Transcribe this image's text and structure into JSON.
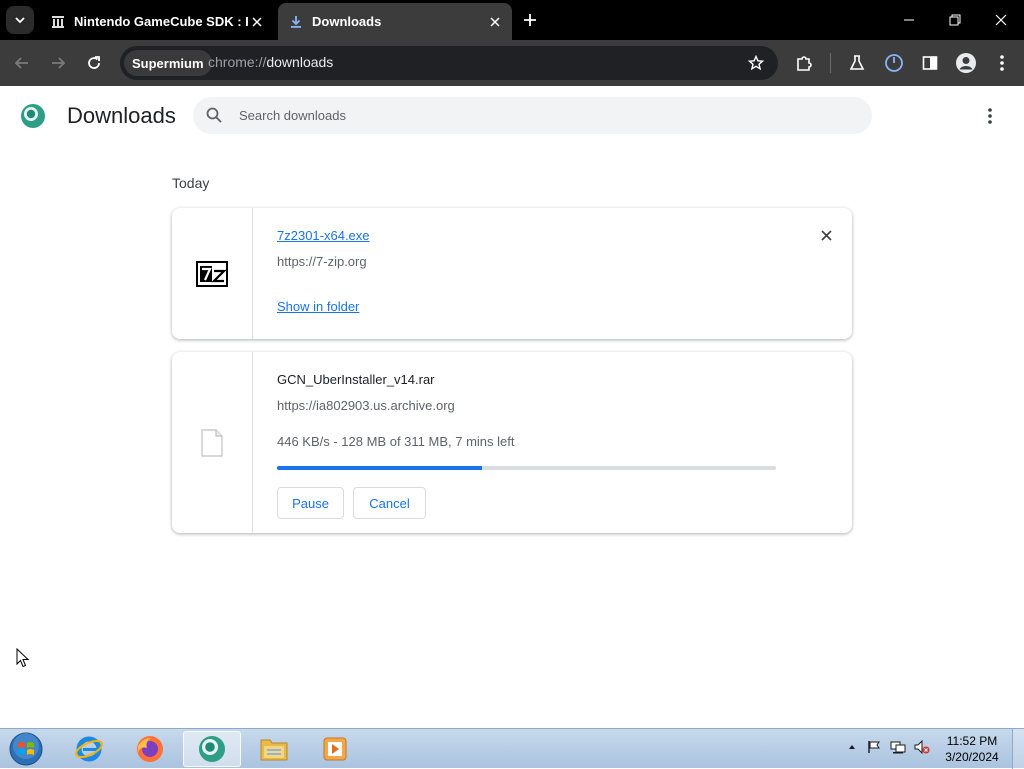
{
  "browser": {
    "tabs": [
      {
        "title": "Nintendo GameCube SDK : Free",
        "active": false
      },
      {
        "title": "Downloads",
        "active": true
      }
    ],
    "omnibox": {
      "chip": "Supermium",
      "url_scheme": "chrome://",
      "url_host": "downloads"
    }
  },
  "page": {
    "title": "Downloads",
    "search_placeholder": "Search downloads",
    "section": "Today"
  },
  "downloads": [
    {
      "filename": "7z2301-x64.exe",
      "source": "https://7-zip.org",
      "action": "Show in folder",
      "icon": "7z-icon"
    },
    {
      "filename": "GCN_UberInstaller_v14.rar",
      "source": "https://ia802903.us.archive.org",
      "status": "446 KB/s - 128 MB of 311 MB, 7 mins left",
      "progress_fraction": 0.41,
      "pause_label": "Pause",
      "cancel_label": "Cancel",
      "icon": "file-icon"
    }
  ],
  "taskbar": {
    "time": "11:52 PM",
    "date": "3/20/2024",
    "apps": [
      "internet-explorer",
      "firefox",
      "supermium",
      "file-explorer",
      "media-player"
    ]
  },
  "colors": {
    "accent": "#1a73e8",
    "tabstrip": "#000000",
    "toolbar": "#3c3c3c"
  }
}
